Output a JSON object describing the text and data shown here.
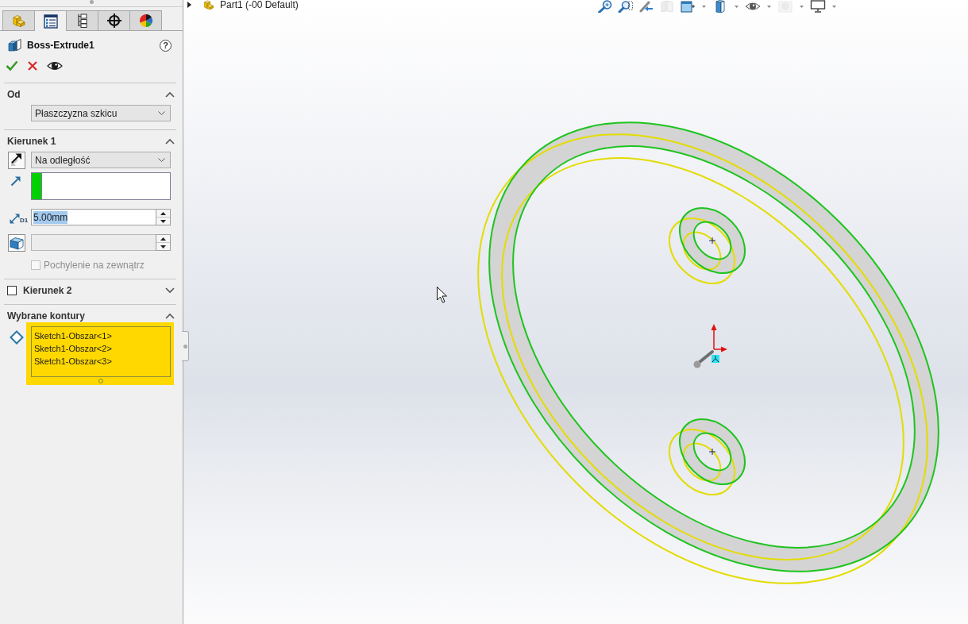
{
  "panel_tabs": [
    {
      "selected": false
    },
    {
      "selected": true
    },
    {
      "selected": false
    },
    {
      "selected": false
    },
    {
      "selected": false
    }
  ],
  "property_manager": {
    "title": "Boss-Extrude1",
    "help_button": "?",
    "sections": [
      {
        "kind": "group",
        "title": "Od",
        "expanded": true,
        "controls": [
          {
            "kind": "dropdown",
            "value": "Płaszczyzna szkicu"
          }
        ]
      },
      {
        "kind": "group",
        "title": "Kierunek 1",
        "expanded": true,
        "controls": [
          {
            "kind": "dropdown",
            "value": "Na odległość"
          },
          {
            "kind": "selection_box"
          },
          {
            "kind": "spin",
            "value": "5.00mm",
            "icon_label": "D1",
            "highlighted": true,
            "disabled": false
          },
          {
            "kind": "spin",
            "disabled": true
          },
          {
            "kind": "checkbox",
            "label": "Pochylenie na zewnątrz",
            "checked": false,
            "disabled": true
          }
        ]
      },
      {
        "kind": "optional_group",
        "title": "Kierunek 2",
        "expanded": false,
        "checked": false
      },
      {
        "kind": "group",
        "title": "Wybrane kontury",
        "expanded": true,
        "controls": [
          {
            "kind": "list",
            "active": true,
            "items": [
              "Sketch1-Obszar<1>",
              "Sketch1-Obszar<2>",
              "Sketch1-Obszar<3>"
            ]
          }
        ]
      }
    ]
  },
  "feature_tree": {
    "expanded": false,
    "label": "Part1 (-00 Default)"
  },
  "view_toolbar": [
    {
      "disabled": false,
      "menu": false
    },
    {
      "disabled": false,
      "menu": false
    },
    {
      "disabled": false,
      "menu": false
    },
    {
      "disabled": true,
      "menu": false
    },
    {
      "disabled": false,
      "menu": true
    },
    {
      "disabled": false,
      "menu": true
    },
    {
      "disabled": false,
      "menu": true
    },
    {
      "disabled": true,
      "menu": true
    },
    {
      "disabled": false,
      "menu": true
    }
  ]
}
